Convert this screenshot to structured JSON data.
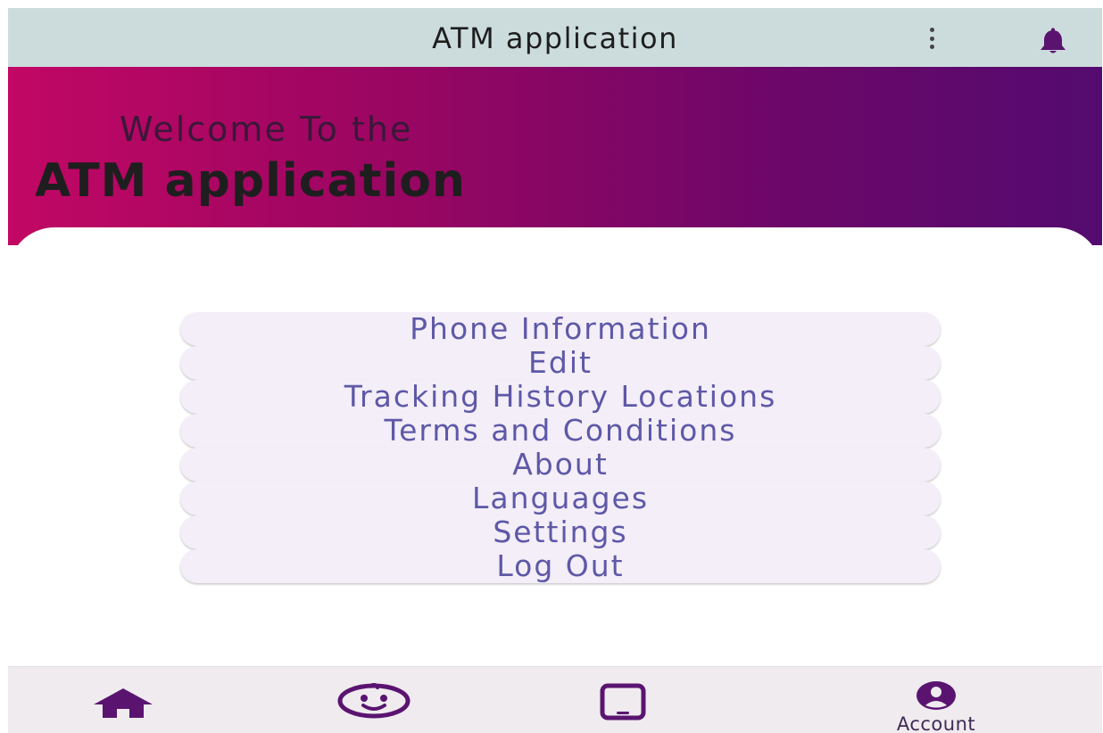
{
  "app_bar": {
    "title": "ATM application",
    "icons": [
      "more-vert-icon",
      "bell-icon"
    ]
  },
  "hero": {
    "line1": "Welcome To the",
    "line2": "ATM application"
  },
  "menu": {
    "items": [
      {
        "label": "Phone Information"
      },
      {
        "label": "Edit"
      },
      {
        "label": "Tracking History Locations"
      },
      {
        "label": "Terms and Conditions"
      },
      {
        "label": "About"
      },
      {
        "label": "Languages"
      },
      {
        "label": "Settings"
      },
      {
        "label": "Log Out"
      }
    ]
  },
  "bottom_nav": {
    "items": [
      {
        "icon": "home-icon",
        "label": ""
      },
      {
        "icon": "face-icon",
        "label": ""
      },
      {
        "icon": "phone-device-icon",
        "label": ""
      },
      {
        "icon": "account-icon",
        "label": "Account",
        "selected": true
      }
    ]
  },
  "colors": {
    "app_bar_bg": "#ccdcdc",
    "gradient_start": "#c20764",
    "gradient_end": "#540b6f",
    "menu_text": "#5e58a8",
    "menu_item_bg": "#f3eef7",
    "nav_icon": "#5a1470",
    "nav_bg": "#efebef"
  }
}
